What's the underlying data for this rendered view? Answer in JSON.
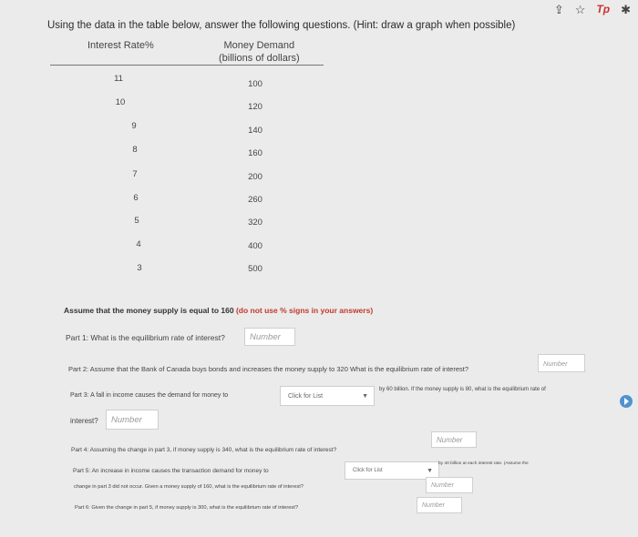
{
  "browser": {
    "icons": [
      "share-icon",
      "star-icon",
      "extension-icon",
      "puzzle-icon"
    ],
    "ext_label": "Tp"
  },
  "title": "Using the data in the table below, answer the following questions. (Hint: draw a graph when possible)",
  "table": {
    "headers": {
      "rate": "Interest Rate%",
      "demand_line1": "Money Demand",
      "demand_line2": "(billions of dollars)"
    },
    "rows": [
      {
        "rate": "11",
        "demand": "100"
      },
      {
        "rate": "10",
        "demand": "120"
      },
      {
        "rate": "9",
        "demand": "140"
      },
      {
        "rate": "8",
        "demand": "160"
      },
      {
        "rate": "7",
        "demand": "200"
      },
      {
        "rate": "6",
        "demand": "260"
      },
      {
        "rate": "5",
        "demand": "320"
      },
      {
        "rate": "4",
        "demand": "400"
      },
      {
        "rate": "3",
        "demand": "500"
      }
    ]
  },
  "assume": {
    "text": "Assume that the money supply is equal to 160",
    "note": "(do not use % signs in your answers)"
  },
  "parts": {
    "p1": {
      "text": "Part 1: What is the equilibrium rate of interest?",
      "placeholder": "Number"
    },
    "p2": {
      "text": "Part 2: Assume that the Bank of Canada buys bonds and increases the money supply to 320 What is the equilibrium rate of interest?",
      "placeholder": "Number"
    },
    "p3": {
      "text_before": "Part 3: A fall in income causes the demand for money to",
      "select": "Click for List",
      "text_after": "by 60 billion. If the money supply is 80, what is the equilibrium rate of",
      "text_line2": "interest?",
      "placeholder": "Number"
    },
    "p4": {
      "text": "Part 4: Assuming the change in part 3, if money supply is 340, what is the equilibrium rate of interest?",
      "placeholder": "Number"
    },
    "p5": {
      "text_before": "Part 5: An increase in income causes the transaction demand for money to",
      "select": "Click for List",
      "text_after": "by 40 billion at each interest rate. (Assume the",
      "text_line2": "change in part 3 did not occur. Given a money supply of 160, what is the equilibrium rate of interest?",
      "placeholder": "Number"
    },
    "p6": {
      "text": "Part 6: Given the change in part 5, if money supply is 300, what is the equilibrium rate of interest?",
      "placeholder": "Number"
    }
  }
}
